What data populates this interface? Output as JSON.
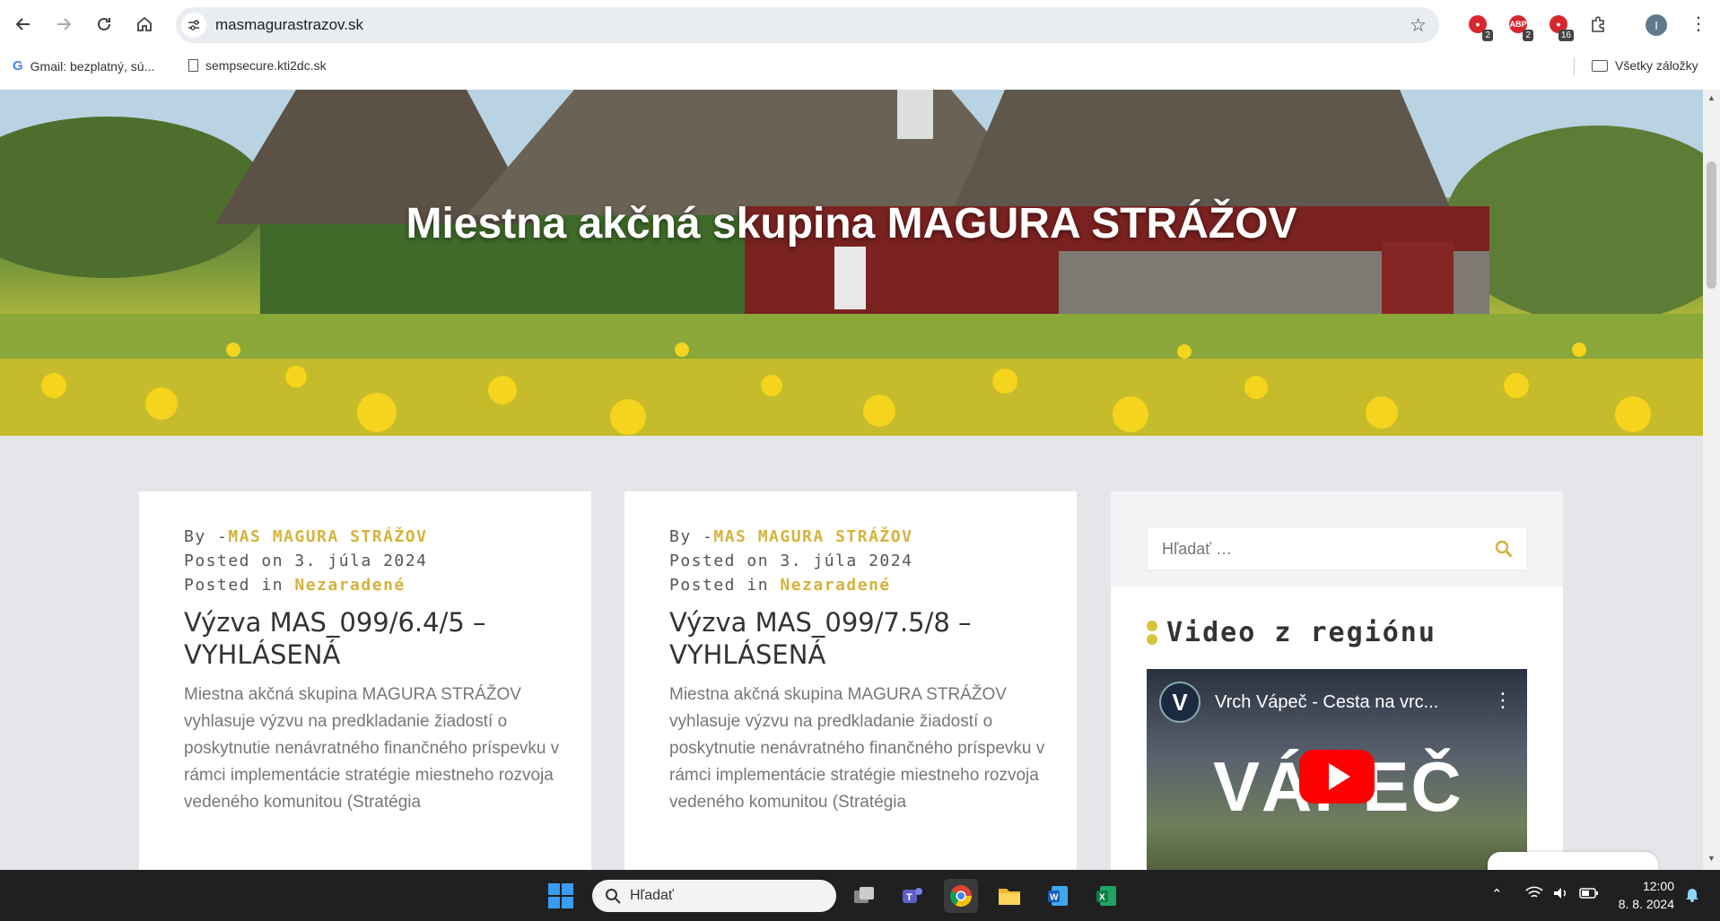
{
  "browser": {
    "url": "masmagurastrazov.sk",
    "extensions": [
      {
        "name": "ext-red-1",
        "badge": "2"
      },
      {
        "name": "ext-abp",
        "badge": "2"
      },
      {
        "name": "ext-red-2",
        "badge": "16"
      }
    ],
    "profile_initial": "I",
    "bookmarks": [
      {
        "label": "Gmail: bezplatný, sú...",
        "icon": "google-icon"
      },
      {
        "label": "sempsecure.kti2dc.sk",
        "icon": "page-icon"
      }
    ],
    "all_bookmarks": "Všetky záložky"
  },
  "hero": {
    "title": "Miestna akčná skupina MAGURA STRÁŽOV"
  },
  "posts": [
    {
      "by_prefix": "By -",
      "author": "MAS MAGURA STRÁŽOV",
      "posted_on_prefix": "Posted on ",
      "date": "3. júla 2024",
      "posted_in_prefix": "Posted in ",
      "category": "Nezaradené",
      "title": "Výzva MAS_099/6.4/5 – VYHLÁSENÁ",
      "excerpt": "Miestna akčná skupina MAGURA STRÁŽOV vyhlasuje výzvu na predkladanie žiadostí o poskytnutie nenávratného finančného príspevku v rámci implementácie stratégie miestneho rozvoja vedeného komunitou (Stratégia"
    },
    {
      "by_prefix": "By -",
      "author": "MAS MAGURA STRÁŽOV",
      "posted_on_prefix": "Posted on ",
      "date": "3. júla 2024",
      "posted_in_prefix": "Posted in ",
      "category": "Nezaradené",
      "title": "Výzva MAS_099/7.5/8 – VYHLÁSENÁ",
      "excerpt": "Miestna akčná skupina MAGURA STRÁŽOV vyhlasuje výzvu na predkladanie žiadostí o poskytnutie nenávratného finančného príspevku v rámci implementácie stratégie miestneho rozvoja vedeného komunitou (Stratégia"
    }
  ],
  "sidebar": {
    "search_placeholder": "Hľadať …",
    "widget_title": "Video z regiónu",
    "video": {
      "channel_initial": "V",
      "title": "Vrch Vápeč - Cesta na vrc...",
      "thumbnail_text": "VÁPEČ"
    }
  },
  "taskbar": {
    "search_placeholder": "Hľadať",
    "time": "12:00",
    "date": "8. 8. 2024"
  },
  "colors": {
    "accent": "#d6b23c",
    "page_bg": "#e6e6ea",
    "taskbar": "#202020"
  }
}
